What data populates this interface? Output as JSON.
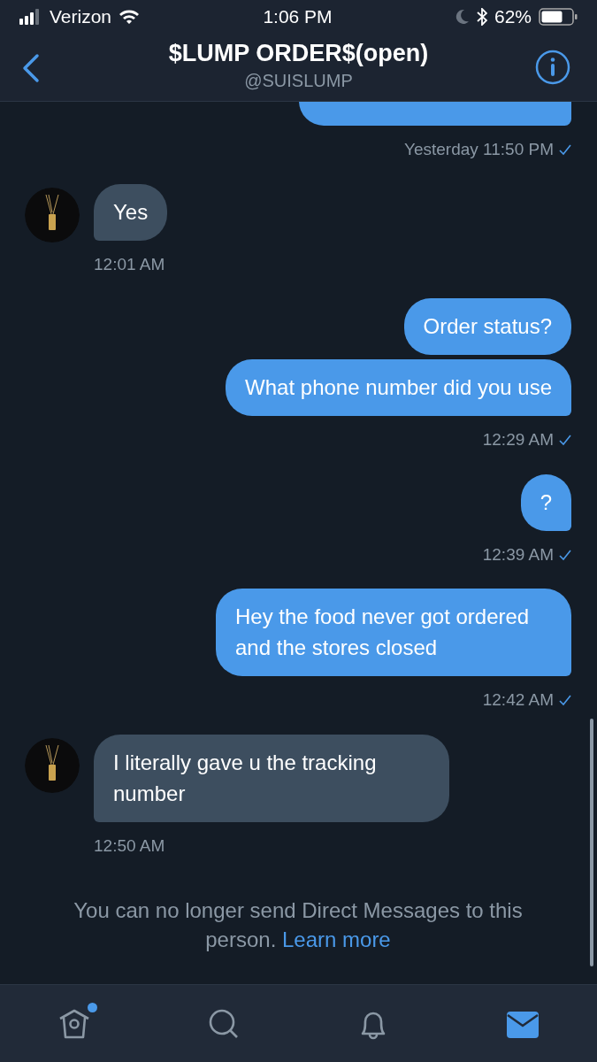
{
  "status_bar": {
    "carrier": "Verizon",
    "time": "1:06 PM",
    "battery": "62%"
  },
  "header": {
    "title": "$LUMP ORDER$(open)",
    "handle": "@SUISLUMP"
  },
  "messages": [
    {
      "kind": "sent",
      "bubbles": [
        {
          "kind": "cut"
        }
      ],
      "time": "Yesterday 11:50 PM"
    },
    {
      "kind": "received",
      "bubbles": [
        {
          "kind": "text",
          "text": "Yes"
        }
      ],
      "time": "12:01 AM"
    },
    {
      "kind": "sent",
      "bubbles": [
        {
          "kind": "text",
          "text": "Order status?"
        },
        {
          "kind": "text",
          "text": "What phone number did you use"
        }
      ],
      "time": "12:29 AM"
    },
    {
      "kind": "sent",
      "bubbles": [
        {
          "kind": "text",
          "text": "?"
        }
      ],
      "time": "12:39 AM"
    },
    {
      "kind": "sent",
      "bubbles": [
        {
          "kind": "text",
          "text": "Hey the food never got ordered and the stores closed"
        }
      ],
      "time": "12:42 AM"
    },
    {
      "kind": "received",
      "bubbles": [
        {
          "kind": "text",
          "text": "I literally gave u the tracking number"
        }
      ],
      "time": "12:50 AM"
    }
  ],
  "notice": {
    "text": "You can no longer send Direct Messages to this person.",
    "link": "Learn more"
  },
  "tabs": [
    {
      "kind": "home",
      "selected": false,
      "unread": true
    },
    {
      "kind": "search",
      "selected": false,
      "unread": false
    },
    {
      "kind": "notifications",
      "selected": false,
      "unread": false
    },
    {
      "kind": "messages",
      "selected": true,
      "unread": false
    }
  ]
}
